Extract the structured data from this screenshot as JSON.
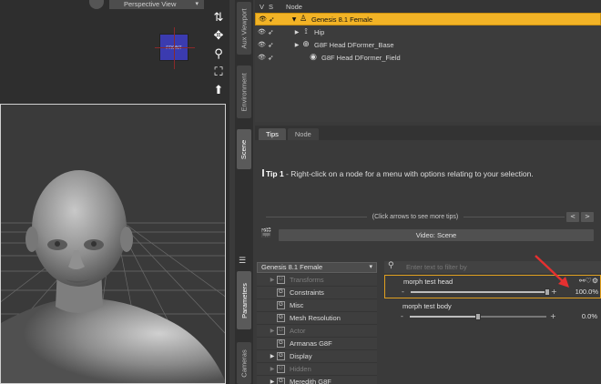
{
  "viewport": {
    "view_label": "Perspective View",
    "cube_label": "FRONT",
    "tools": [
      {
        "name": "camera-orbit-icon",
        "glyph": "⇅"
      },
      {
        "name": "camera-pan-icon",
        "glyph": "✥"
      },
      {
        "name": "zoom-icon",
        "glyph": "⚲"
      },
      {
        "name": "frame-icon",
        "glyph": "⛶"
      },
      {
        "name": "reset-view-icon",
        "glyph": "⬆"
      }
    ]
  },
  "side_tabs": {
    "aux_viewport": "Aux Viewport",
    "environment": "Environment",
    "scene": "Scene",
    "parameters": "Parameters",
    "cameras": "Cameras"
  },
  "scene": {
    "col_v": "V",
    "col_s": "S",
    "col_node": "Node",
    "rows": [
      {
        "label": "Genesis 8.1 Female",
        "selected": true,
        "indent": 0,
        "expand": "▼",
        "icon": "♙"
      },
      {
        "label": "Hip",
        "selected": false,
        "indent": 4,
        "expand": "▶",
        "icon": "⟟"
      },
      {
        "label": "G8F Head DFormer_Base",
        "selected": false,
        "indent": 4,
        "expand": "▶",
        "icon": "⊕"
      },
      {
        "label": "G8F Head DFormer_Field",
        "selected": false,
        "indent": 12,
        "expand": "",
        "icon": "◉"
      }
    ]
  },
  "tips": {
    "tabs": [
      "Tips",
      "Node"
    ],
    "tip_number": "Tip 1",
    "tip_body": " - Right-click on a node for a menu with options relating to your selection.",
    "hint": "(Click arrows to see more tips)",
    "prev": "<",
    "next": ">",
    "video_button": "Video: Scene"
  },
  "parameters": {
    "figure": "Genesis 8.1 Female",
    "search_placeholder": "Enter text to filter by",
    "tree": [
      {
        "label": "Transforms",
        "dim": true,
        "arrow": "▶"
      },
      {
        "label": "Constraints",
        "dim": false,
        "arrow": ""
      },
      {
        "label": "Misc",
        "dim": false,
        "arrow": ""
      },
      {
        "label": "Mesh Resolution",
        "dim": false,
        "arrow": ""
      },
      {
        "label": "Actor",
        "dim": true,
        "arrow": "▶"
      },
      {
        "label": "Armanas G8F",
        "dim": false,
        "arrow": ""
      },
      {
        "label": "Display",
        "dim": false,
        "arrow": "▶"
      },
      {
        "label": "Hidden",
        "dim": true,
        "arrow": "▶"
      },
      {
        "label": "Meredith G8F",
        "dim": false,
        "arrow": "▶"
      }
    ],
    "sliders": [
      {
        "name": "morph test head",
        "value": "100.0%",
        "fraction": 1.0,
        "selected": true,
        "tools": "⚯♡⚙"
      },
      {
        "name": "morph test body",
        "value": "0.0%",
        "fraction": 0.5,
        "selected": false,
        "tools": ""
      }
    ],
    "minus": "-",
    "plus": "+"
  },
  "colors": {
    "selection": "#f2b326",
    "annotation": "#e53030"
  }
}
